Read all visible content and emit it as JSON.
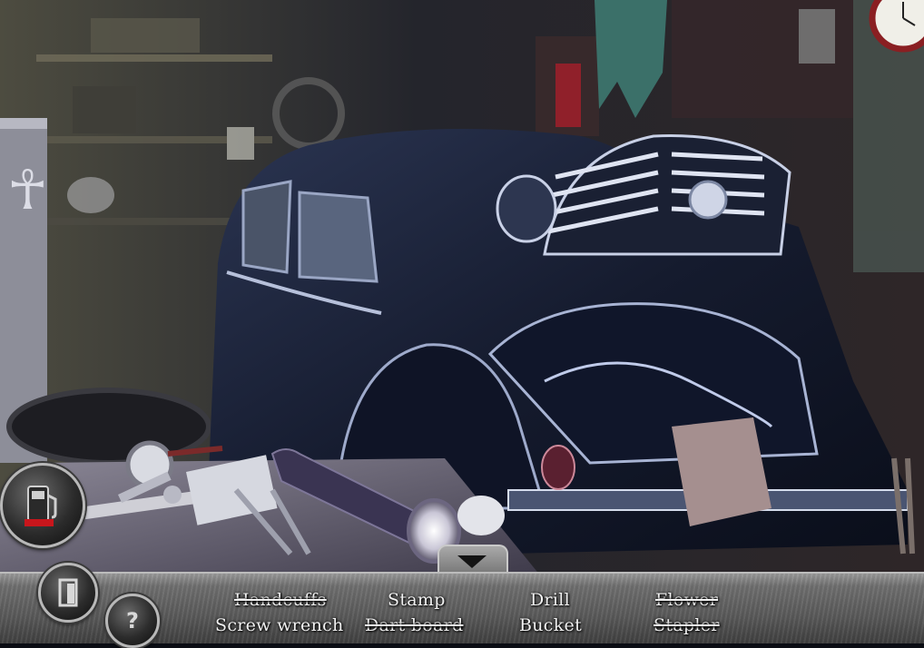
{
  "scene": {
    "name": "garage",
    "colors": {
      "car_body": "#1b2236",
      "car_highlight": "#8fa0c8",
      "wall": "#2a2a30",
      "table": "#4a4656"
    }
  },
  "hud": {
    "items": [
      {
        "label": "Handcuffs",
        "found": true
      },
      {
        "label": "Stamp",
        "found": false
      },
      {
        "label": "Drill",
        "found": false
      },
      {
        "label": "Flower",
        "found": true
      },
      {
        "label": "Screw wrench",
        "found": false
      },
      {
        "label": "Dart board",
        "found": true
      },
      {
        "label": "Bucket",
        "found": false
      },
      {
        "label": "Stapler",
        "found": true
      }
    ],
    "buttons": {
      "hint_icon": "fuel-pump-icon",
      "exit_icon": "door-icon",
      "help_label": "?"
    }
  }
}
